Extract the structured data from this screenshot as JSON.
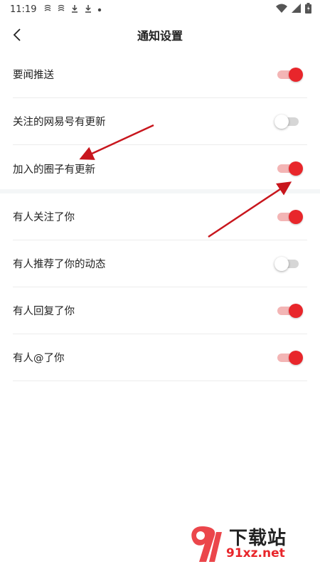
{
  "status_bar": {
    "time": "11:19",
    "left_icons": [
      "notification-icon",
      "notification-icon",
      "download-icon",
      "download-icon",
      "dot-icon"
    ],
    "right_icons": [
      "wifi-icon",
      "signal-icon",
      "battery-icon"
    ]
  },
  "header": {
    "title": "通知设置",
    "back_icon": "chevron-left-icon"
  },
  "settings": {
    "group1": [
      {
        "label": "要闻推送",
        "enabled": true
      },
      {
        "label": "关注的网易号有更新",
        "enabled": false
      },
      {
        "label": "加入的圈子有更新",
        "enabled": true
      }
    ],
    "group2": [
      {
        "label": "有人关注了你",
        "enabled": true
      },
      {
        "label": "有人推荐了你的动态",
        "enabled": false
      },
      {
        "label": "有人回复了你",
        "enabled": true
      },
      {
        "label": "有人@了你",
        "enabled": true
      }
    ]
  },
  "colors": {
    "accent": "#e8262b",
    "toggle_track_on": "#f3b5b5",
    "toggle_track_off": "#d6d6d6",
    "arrow": "#c8161d"
  },
  "watermark": {
    "brand": "下载站",
    "site": "91xz.net",
    "logo_icon": "91-logo-icon"
  }
}
